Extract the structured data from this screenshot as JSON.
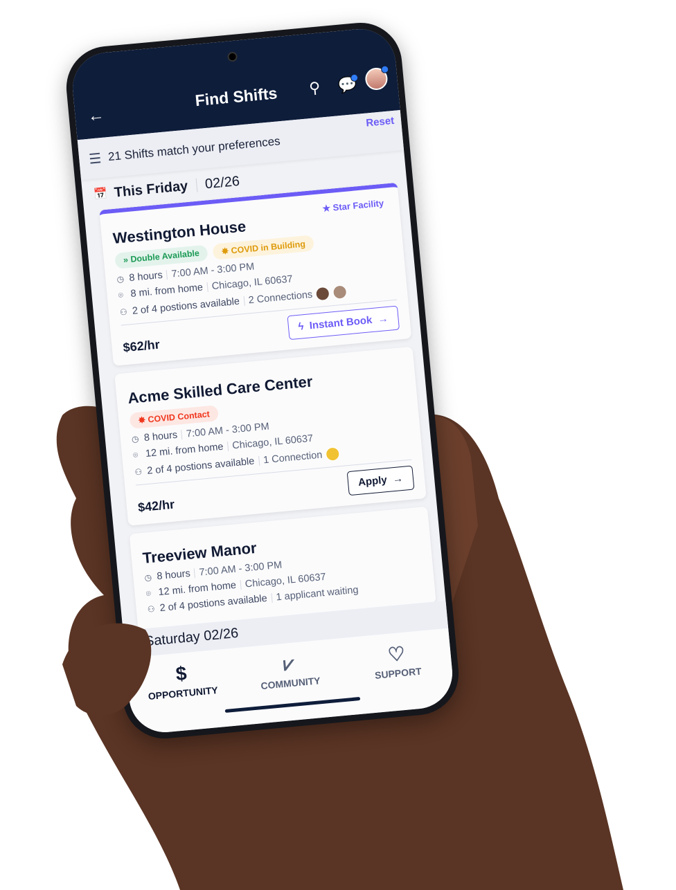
{
  "header": {
    "title": "Find Shifts",
    "back_icon": "arrow-left-icon",
    "search_icon": "search-icon",
    "chat_icon": "chat-icon"
  },
  "filter": {
    "summary": "21 Shifts match your preferences",
    "reset_label": "Reset"
  },
  "date_group": {
    "day": "This Friday",
    "date": "02/26"
  },
  "shifts": [
    {
      "facility": "Westington House",
      "star": "Star Facility",
      "tags": [
        {
          "label": "Double Available",
          "color": "#1c9a55"
        },
        {
          "label": "COVID in Building",
          "color": "#de9a0b"
        }
      ],
      "hours": "8 hours",
      "time": "7:00 AM - 3:00 PM",
      "distance": "8 mi. from home",
      "location": "Chicago, IL 60637",
      "positions": "2 of 4 postions available",
      "extra": "2 Connections",
      "price": "$62/hr",
      "action": "Instant Book"
    },
    {
      "facility": "Acme Skilled Care Center",
      "tags": [
        {
          "label": "COVID Contact",
          "color": "#f0361d"
        }
      ],
      "hours": "8 hours",
      "time": "7:00 AM - 3:00 PM",
      "distance": "12 mi. from home",
      "location": "Chicago, IL 60637",
      "positions": "2 of 4 postions available",
      "extra": "1 Connection",
      "price": "$42/hr",
      "action": "Apply"
    },
    {
      "facility": "Treeview Manor",
      "hours": "8 hours",
      "time": "7:00 AM - 3:00 PM",
      "distance": "12 mi. from home",
      "location": "Chicago, IL 60637",
      "positions": "2 of 4 postions available",
      "extra": "1 applicant waiting"
    }
  ],
  "next_group": "Saturday 02/26",
  "nav": [
    {
      "label": "OPPORTUNITY",
      "icon": "dollar-icon",
      "active": true
    },
    {
      "label": "COMMUNITY",
      "icon": "community-icon"
    },
    {
      "label": "SUPPORT",
      "icon": "heart-icon"
    }
  ],
  "colors": {
    "header": "#0e1d3a",
    "accent": "#6c5cf6",
    "notification": "#2f7cf6"
  }
}
